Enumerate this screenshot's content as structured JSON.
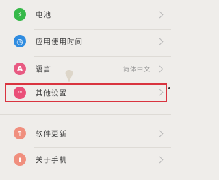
{
  "settings": {
    "items": [
      {
        "label": "电池",
        "icon": "lightning-icon",
        "color": "#36b949",
        "glyph": "⚡"
      },
      {
        "label": "应用使用时间",
        "icon": "clock-icon",
        "color": "#2f8ce0",
        "glyph": "◷"
      },
      {
        "label": "语言",
        "value": "简体中文",
        "icon": "language-a-icon",
        "color": "#e85a82",
        "glyph": "A"
      },
      {
        "label": "其他设置",
        "icon": "more-dots-icon",
        "color": "#ea4f78",
        "glyph": "···"
      },
      {
        "label": "软件更新",
        "icon": "arrow-up-icon",
        "color": "#f08f7e",
        "glyph": "↑"
      },
      {
        "label": "关于手机",
        "icon": "info-icon",
        "color": "#f08f7e",
        "glyph": "i"
      }
    ]
  }
}
